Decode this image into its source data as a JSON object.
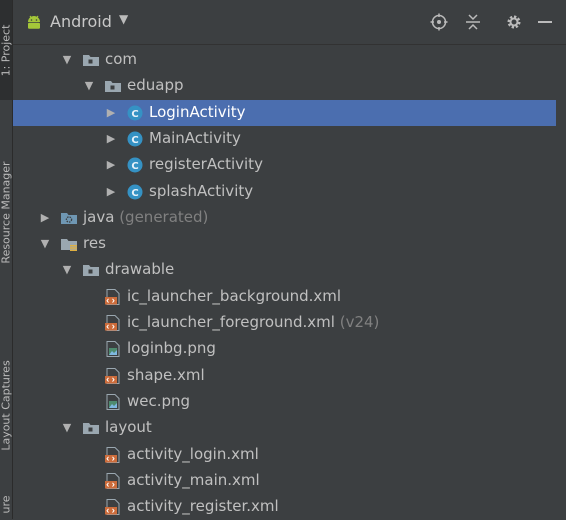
{
  "header": {
    "title": "Android",
    "dropdown_icon": "triangle-down-icon",
    "actions": [
      "target-icon",
      "collapse-icon",
      "gear-icon",
      "minimize-icon"
    ]
  },
  "left_strip": {
    "tabs": [
      "1: Project",
      "Resource Manager",
      "Layout Captures",
      "ure"
    ]
  },
  "tree": {
    "rows": [
      {
        "label": "com",
        "indent": 2,
        "arrow": "expanded",
        "icon": "package"
      },
      {
        "label": "eduapp",
        "indent": 3,
        "arrow": "expanded",
        "icon": "package"
      },
      {
        "label": "LoginActivity",
        "indent": 4,
        "arrow": "collapsed",
        "icon": "class",
        "selected": true
      },
      {
        "label": "MainActivity",
        "indent": 4,
        "arrow": "collapsed",
        "icon": "class"
      },
      {
        "label": "registerActivity",
        "indent": 4,
        "arrow": "collapsed",
        "icon": "class"
      },
      {
        "label": "splashActivity",
        "indent": 4,
        "arrow": "collapsed",
        "icon": "class"
      },
      {
        "label": "java",
        "suffix": " (generated)",
        "indent": 1,
        "arrow": "collapsed",
        "icon": "generated-folder"
      },
      {
        "label": "res",
        "indent": 1,
        "arrow": "expanded",
        "icon": "res-folder"
      },
      {
        "label": "drawable",
        "indent": 2,
        "arrow": "expanded",
        "icon": "folder"
      },
      {
        "label": "ic_launcher_background.xml",
        "indent": 3,
        "arrow": "none",
        "icon": "xml"
      },
      {
        "label": "ic_launcher_foreground.xml",
        "suffix": " (v24)",
        "indent": 3,
        "arrow": "none",
        "icon": "xml"
      },
      {
        "label": "loginbg.png",
        "indent": 3,
        "arrow": "none",
        "icon": "image"
      },
      {
        "label": "shape.xml",
        "indent": 3,
        "arrow": "none",
        "icon": "xml"
      },
      {
        "label": "wec.png",
        "indent": 3,
        "arrow": "none",
        "icon": "image"
      },
      {
        "label": "layout",
        "indent": 2,
        "arrow": "expanded",
        "icon": "folder"
      },
      {
        "label": "activity_login.xml",
        "indent": 3,
        "arrow": "none",
        "icon": "xml"
      },
      {
        "label": "activity_main.xml",
        "indent": 3,
        "arrow": "none",
        "icon": "xml"
      },
      {
        "label": "activity_register.xml",
        "indent": 3,
        "arrow": "none",
        "icon": "xml"
      }
    ]
  },
  "colors": {
    "selection": "#4b6eaf",
    "background": "#3c3f41",
    "class_icon": "#3592c4",
    "xml_icon": "#cc6c3b",
    "folder_icon": "#9aa7b0"
  }
}
